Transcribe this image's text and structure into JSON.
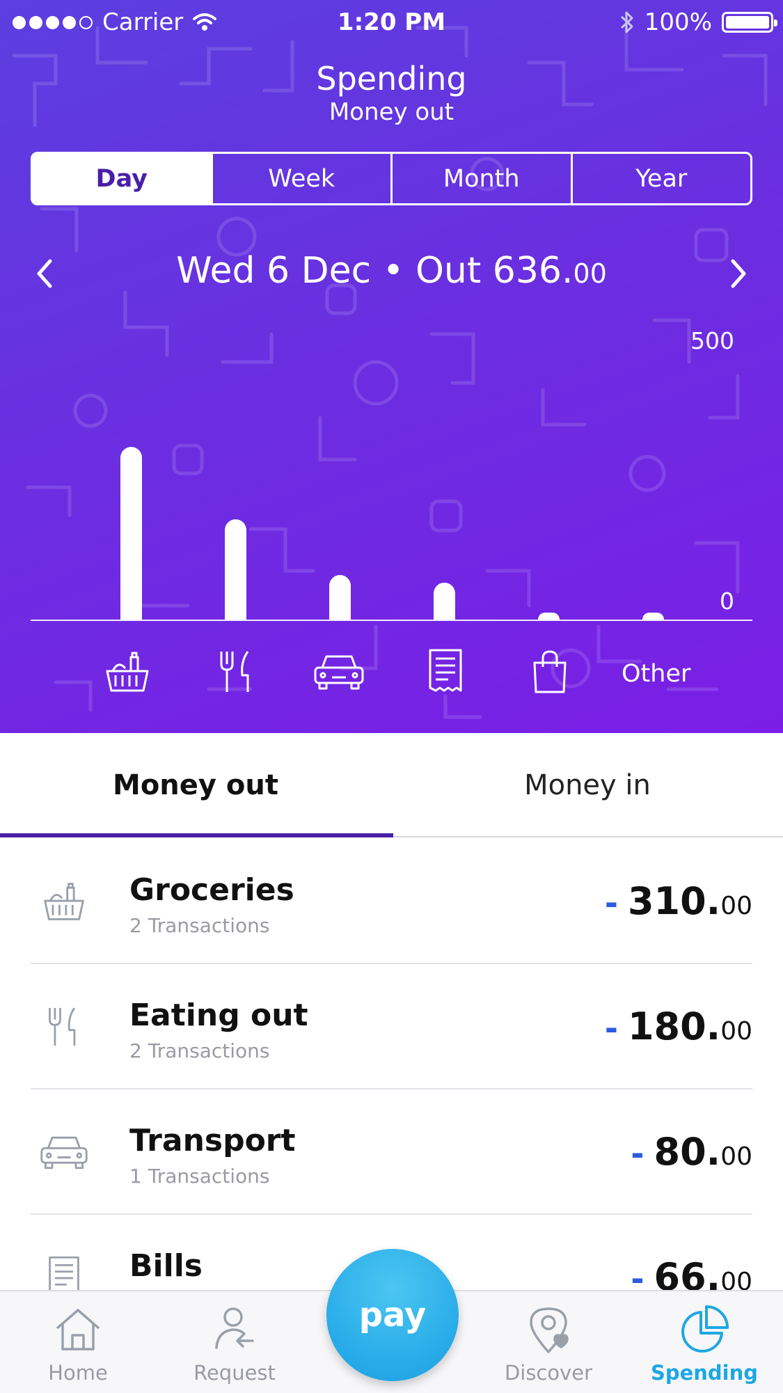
{
  "status_bar": {
    "carrier": "Carrier",
    "time": "1:20 PM",
    "battery": "100%",
    "signal_dots_filled": 4,
    "signal_dots_total": 5
  },
  "header": {
    "title": "Spending",
    "subtitle": "Money out"
  },
  "periods": {
    "day": "Day",
    "week": "Week",
    "month": "Month",
    "year": "Year",
    "selected": "Day"
  },
  "date_bar": {
    "date": "Wed 6 Dec",
    "separator": "•",
    "out_prefix": "Out 636.",
    "out_decimals": "00",
    "prev_icon": "chevron-left-icon",
    "next_icon": "chevron-right-icon"
  },
  "chart_data": {
    "type": "bar",
    "categories": [
      "Groceries",
      "Eating out",
      "Transport",
      "Bills",
      "Shopping",
      "Other"
    ],
    "values": [
      310,
      180,
      80,
      66,
      8,
      8
    ],
    "ylim": [
      0,
      500
    ],
    "y_tick_labels": [
      "500",
      "0"
    ],
    "category_icons": [
      "groceries-icon",
      "eating-out-icon",
      "transport-icon",
      "bills-icon",
      "shopping-icon",
      ""
    ],
    "other_label": "Other",
    "bar_color": "#ffffff"
  },
  "tabs": {
    "money_out": "Money out",
    "money_in": "Money in",
    "active": "money_out",
    "underline_color": "#4a1fa8"
  },
  "transactions": [
    {
      "name": "Groceries",
      "sub": "2 Transactions",
      "minus": "-",
      "amount": "310.",
      "decimals": "00",
      "icon": "groceries-icon"
    },
    {
      "name": "Eating out",
      "sub": "2 Transactions",
      "minus": "-",
      "amount": "180.",
      "decimals": "00",
      "icon": "eating-out-icon"
    },
    {
      "name": "Transport",
      "sub": "1 Transactions",
      "minus": "-",
      "amount": "80.",
      "decimals": "00",
      "icon": "transport-icon"
    },
    {
      "name": "Bills",
      "sub": "",
      "minus": "-",
      "amount": "66.",
      "decimals": "00",
      "icon": "bills-icon"
    }
  ],
  "tabbar": {
    "home": "Home",
    "request": "Request",
    "pay": "pay",
    "discover": "Discover",
    "spending": "Spending",
    "active_color": "#1ea7e2"
  },
  "colors": {
    "purple_start": "#5b3fe0",
    "purple_end": "#7a1ee6",
    "minus_blue": "#2b5be0"
  }
}
